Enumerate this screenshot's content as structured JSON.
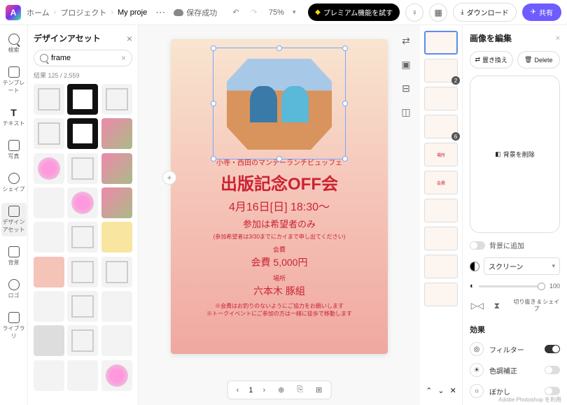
{
  "topbar": {
    "home": "ホーム",
    "projects": "プロジェクト",
    "current": "My proje",
    "save": "保存成功",
    "zoom": "75%",
    "premium": "プレミアム機能を試す",
    "download": "ダウンロード",
    "share": "共有"
  },
  "rail": {
    "search": "検索",
    "template": "テンプレート",
    "text": "テキスト",
    "photo": "写真",
    "shape": "シェイプ",
    "asset": "デザインアセット",
    "bg": "背景",
    "logo": "ロゴ",
    "library": "ライブラリ"
  },
  "panel": {
    "title": "デザインアセット",
    "search_value": "frame",
    "count": "結果 125 / 2,559"
  },
  "canvas": {
    "subtitle": "小寺・西田のマンデーランチビュッフェ",
    "title": "出版記念OFF会",
    "date": "4月16日[日] 18:30～",
    "participation": "参加は希望者のみ",
    "note": "(参加希望者は3/30までにカイまで申し出てください)",
    "fee_label": "会費",
    "fee": "会費 5,000円",
    "place_label": "場所",
    "place": "六本木 豚組",
    "footer1": "※会費はお釣りのないようにご協力をお願いします",
    "footer2": "※トークイベントにご参加の方は一緒に徒歩で移動します"
  },
  "thumbs": {
    "b2": "2",
    "b6": "6",
    "place": "場所",
    "fee": "会費"
  },
  "right": {
    "title": "画像を編集",
    "replace": "置き換え",
    "delete": "Delete",
    "removebg": "背景を削除",
    "addbg": "背景に追加",
    "blend": "スクリーン",
    "opacity": "100",
    "crop": "切り抜き & シェイプ",
    "effects": "効果",
    "filter": "フィルター",
    "tone": "色調補正",
    "blur": "ぼかし"
  },
  "bottombar": {
    "page": "1"
  },
  "footer": "Adobe Photoshop を利用"
}
